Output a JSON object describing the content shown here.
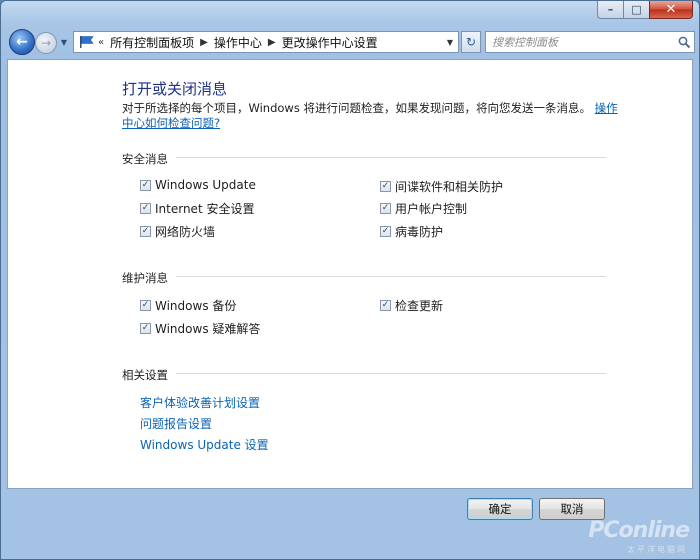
{
  "window": {
    "caption": {
      "minimize": "–",
      "maximize": "□",
      "close": "✕"
    }
  },
  "nav": {
    "back_glyph": "←",
    "forward_glyph": "→",
    "breadcrumb_prefix": "«",
    "breadcrumbs": [
      "所有控制面板项",
      "操作中心",
      "更改操作中心设置"
    ],
    "refresh_glyph": "↻",
    "search_placeholder": "搜索控制面板"
  },
  "main": {
    "title": "打开或关闭消息",
    "description": "对于所选择的每个项目，Windows 将进行问题检查，如果发现问题，将向您发送一条消息。",
    "help_link": "操作中心如何检查问题?",
    "security": {
      "header": "安全消息",
      "items": [
        {
          "label": "Windows Update",
          "checked": true
        },
        {
          "label": "Internet 安全设置",
          "checked": true
        },
        {
          "label": "网络防火墙",
          "checked": true
        },
        {
          "label": "间谍软件和相关防护",
          "checked": true
        },
        {
          "label": "用户帐户控制",
          "checked": true
        },
        {
          "label": "病毒防护",
          "checked": true
        }
      ]
    },
    "maintenance": {
      "header": "维护消息",
      "items": [
        {
          "label": "Windows 备份",
          "checked": true
        },
        {
          "label": "Windows 疑难解答",
          "checked": true
        },
        {
          "label": "检查更新",
          "checked": true
        }
      ]
    },
    "related": {
      "header": "相关设置",
      "links": [
        "客户体验改善计划设置",
        "问题报告设置",
        "Windows Update 设置"
      ]
    }
  },
  "buttons": {
    "ok": "确定",
    "cancel": "取消"
  },
  "watermark": {
    "text": "PConline",
    "sub": "太平洋电脑网"
  },
  "colors": {
    "link": "#0b63b5",
    "title": "#1e3287",
    "frame": "#a9c6e6"
  }
}
